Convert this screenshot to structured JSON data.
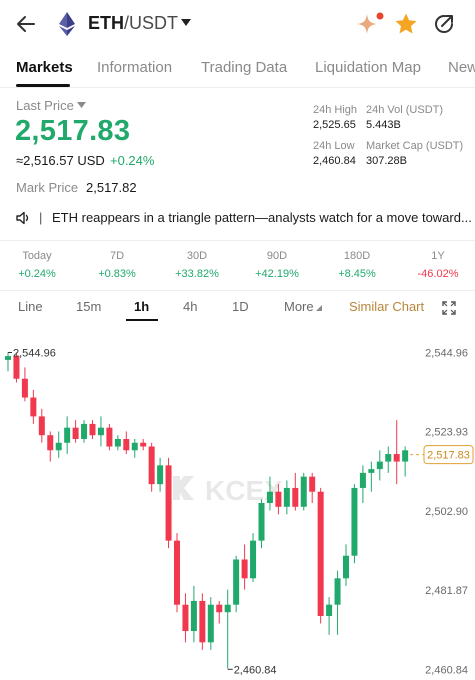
{
  "header": {
    "base": "ETH",
    "quote": "/USDT"
  },
  "tabs": [
    "Markets",
    "Information",
    "Trading Data",
    "Liquidation Map",
    "New"
  ],
  "price": {
    "last_label": "Last Price",
    "last": "2,517.83",
    "usd": "≈2,516.57 USD",
    "change": "+0.24%",
    "mark_label": "Mark Price",
    "mark": "2,517.82"
  },
  "stats": {
    "high_label": "24h High",
    "high": "2,525.65",
    "vol_label": "24h Vol (USDT)",
    "vol": "5.443B",
    "low_label": "24h Low",
    "low": "2,460.84",
    "cap_label": "Market Cap (USDT)",
    "cap": "307.28B"
  },
  "news": {
    "sep": "|",
    "text": "ETH reappears in a triangle pattern—analysts watch for a move toward..."
  },
  "periods": [
    {
      "label": "Today",
      "value": "+0.24%",
      "dir": "up"
    },
    {
      "label": "7D",
      "value": "+0.83%",
      "dir": "up"
    },
    {
      "label": "30D",
      "value": "+33.82%",
      "dir": "up"
    },
    {
      "label": "90D",
      "value": "+42.19%",
      "dir": "up"
    },
    {
      "label": "180D",
      "value": "+8.45%",
      "dir": "up"
    },
    {
      "label": "1Y",
      "value": "-46.02%",
      "dir": "down"
    }
  ],
  "intervals": [
    "Line",
    "15m",
    "1h",
    "4h",
    "1D",
    "More"
  ],
  "similar_chart": "Similar Chart",
  "watermark": "KCEX",
  "colors": {
    "up": "#21a96c",
    "down": "#f0384e",
    "accent": "#b8863b"
  },
  "chart_data": {
    "type": "candlestick",
    "y_ticks": [
      "2,544.96",
      "2,523.93",
      "2,502.90",
      "2,481.87",
      "2,460.84"
    ],
    "ylim": [
      2458.0,
      2552.0
    ],
    "max_label": "2,544.96",
    "min_label": "2,460.84",
    "current_label": "2,517.83",
    "candles": [
      {
        "o": 2543,
        "h": 2545,
        "l": 2540,
        "c": 2544
      },
      {
        "o": 2544,
        "h": 2545,
        "l": 2537,
        "c": 2538
      },
      {
        "o": 2538,
        "h": 2541,
        "l": 2532,
        "c": 2533
      },
      {
        "o": 2533,
        "h": 2535,
        "l": 2526,
        "c": 2528
      },
      {
        "o": 2528,
        "h": 2530,
        "l": 2521,
        "c": 2523
      },
      {
        "o": 2523,
        "h": 2524,
        "l": 2516,
        "c": 2519
      },
      {
        "o": 2519,
        "h": 2524,
        "l": 2517,
        "c": 2521
      },
      {
        "o": 2521,
        "h": 2528,
        "l": 2518,
        "c": 2525
      },
      {
        "o": 2525,
        "h": 2527,
        "l": 2521,
        "c": 2522
      },
      {
        "o": 2522,
        "h": 2527,
        "l": 2521,
        "c": 2526
      },
      {
        "o": 2526,
        "h": 2527,
        "l": 2522,
        "c": 2523
      },
      {
        "o": 2523,
        "h": 2528,
        "l": 2520,
        "c": 2525
      },
      {
        "o": 2525,
        "h": 2526,
        "l": 2519,
        "c": 2520
      },
      {
        "o": 2520,
        "h": 2523,
        "l": 2519,
        "c": 2522
      },
      {
        "o": 2522,
        "h": 2524,
        "l": 2518,
        "c": 2519
      },
      {
        "o": 2519,
        "h": 2522,
        "l": 2517,
        "c": 2521
      },
      {
        "o": 2521,
        "h": 2522,
        "l": 2519,
        "c": 2520
      },
      {
        "o": 2520,
        "h": 2521,
        "l": 2508,
        "c": 2510
      },
      {
        "o": 2510,
        "h": 2517,
        "l": 2508,
        "c": 2515
      },
      {
        "o": 2515,
        "h": 2517,
        "l": 2493,
        "c": 2495
      },
      {
        "o": 2495,
        "h": 2497,
        "l": 2476,
        "c": 2478
      },
      {
        "o": 2478,
        "h": 2481,
        "l": 2468,
        "c": 2471
      },
      {
        "o": 2471,
        "h": 2483,
        "l": 2468,
        "c": 2479
      },
      {
        "o": 2479,
        "h": 2481,
        "l": 2466,
        "c": 2468
      },
      {
        "o": 2468,
        "h": 2480,
        "l": 2466,
        "c": 2478
      },
      {
        "o": 2478,
        "h": 2479,
        "l": 2473,
        "c": 2476
      },
      {
        "o": 2476,
        "h": 2482,
        "l": 2461,
        "c": 2478
      },
      {
        "o": 2478,
        "h": 2491,
        "l": 2476,
        "c": 2490
      },
      {
        "o": 2490,
        "h": 2494,
        "l": 2482,
        "c": 2485
      },
      {
        "o": 2485,
        "h": 2497,
        "l": 2484,
        "c": 2495
      },
      {
        "o": 2495,
        "h": 2506,
        "l": 2493,
        "c": 2505
      },
      {
        "o": 2505,
        "h": 2512,
        "l": 2503,
        "c": 2508
      },
      {
        "o": 2508,
        "h": 2510,
        "l": 2502,
        "c": 2504
      },
      {
        "o": 2504,
        "h": 2511,
        "l": 2502,
        "c": 2509
      },
      {
        "o": 2509,
        "h": 2513,
        "l": 2503,
        "c": 2504
      },
      {
        "o": 2504,
        "h": 2513,
        "l": 2503,
        "c": 2512
      },
      {
        "o": 2512,
        "h": 2513,
        "l": 2505,
        "c": 2508
      },
      {
        "o": 2508,
        "h": 2509,
        "l": 2473,
        "c": 2475
      },
      {
        "o": 2475,
        "h": 2480,
        "l": 2470,
        "c": 2478
      },
      {
        "o": 2478,
        "h": 2487,
        "l": 2470,
        "c": 2485
      },
      {
        "o": 2485,
        "h": 2494,
        "l": 2483,
        "c": 2491
      },
      {
        "o": 2491,
        "h": 2510,
        "l": 2489,
        "c": 2509
      },
      {
        "o": 2509,
        "h": 2515,
        "l": 2505,
        "c": 2513
      },
      {
        "o": 2513,
        "h": 2516,
        "l": 2508,
        "c": 2514
      },
      {
        "o": 2514,
        "h": 2519,
        "l": 2511,
        "c": 2516
      },
      {
        "o": 2516,
        "h": 2520,
        "l": 2513,
        "c": 2518
      },
      {
        "o": 2518,
        "h": 2527,
        "l": 2510,
        "c": 2516
      },
      {
        "o": 2516,
        "h": 2520,
        "l": 2512,
        "c": 2519
      }
    ]
  }
}
